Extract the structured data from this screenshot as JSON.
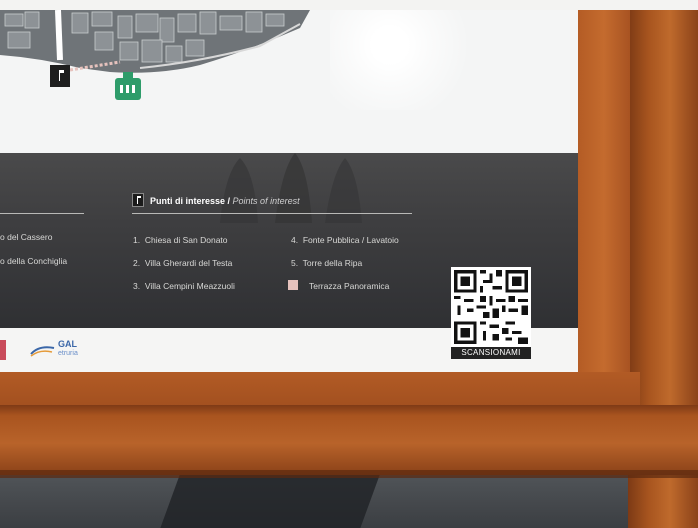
{
  "section": {
    "title": "Punti di interesse",
    "subtitle": "Points of interest"
  },
  "left_items": [
    "o del Cassero",
    "o della Conchiglia"
  ],
  "points": [
    {
      "num": "1.",
      "label": "Chiesa di San Donato"
    },
    {
      "num": "2.",
      "label": "Villa Gherardi del Testa"
    },
    {
      "num": "3.",
      "label": "Villa Cempini Meazzuoli"
    },
    {
      "num": "4.",
      "label": "Fonte Pubblica / Lavatoio"
    },
    {
      "num": "5.",
      "label": "Torre della Ripa"
    }
  ],
  "terrace": {
    "label": "Terrazza Panoramica",
    "swatch_color": "#e6c2bd"
  },
  "qr": {
    "label": "SCANSIONAMI"
  },
  "logo": {
    "name": "GAL",
    "sub": "etruria"
  },
  "colors": {
    "rust": "#b05a26",
    "panel": "#f4f5f5",
    "band": "#3e3e40",
    "marker_green": "#2e9c6a"
  }
}
